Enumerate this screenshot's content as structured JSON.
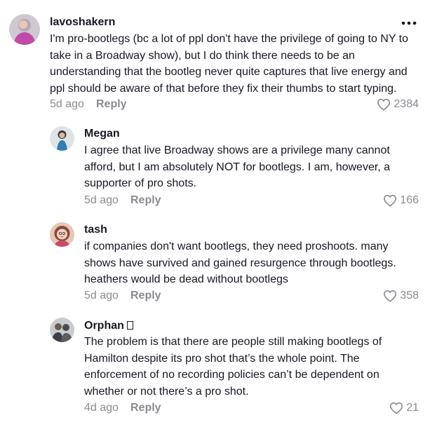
{
  "comments": [
    {
      "username": "lavoshakern",
      "text": "I'm pro-bootlegs (bc a lot of ppl don't have the privilege of going to NY to take in a Broadway show), but I do think there needs to be an understanding that the bootleg never quite captures that live energy and ppl should be aware of that before they fix their thumbs to start typing.",
      "time": "5d ago",
      "reply_label": "Reply",
      "likes": "2384"
    },
    {
      "username": "Megan",
      "text": "I agree that live Broadway shows are a privilege many cannot afford, but I am absolutely NOT for bootlegs. I am, however, a supporter of pro shots.",
      "time": "5d ago",
      "reply_label": "Reply",
      "likes": "166"
    },
    {
      "username": "tash",
      "text": "if companies don't want bootlegs, they need proshoots. many shows have survived and gained resurgence through bootlegs. heathers would be dead without bootlegs",
      "time": "5d ago",
      "reply_label": "Reply",
      "likes": "358"
    },
    {
      "username": "Orphan",
      "text": "The problem is that there are people still making bootlegs of Hamilton despite its pro shot that’s the whole point. The enforcement of no recording policies can’t be dependent on whether or not there’s a pro shot.",
      "time": "4d ago",
      "reply_label": "Reply",
      "likes": "21"
    }
  ],
  "icons": {
    "more": "more-options-icon",
    "like": "heart-outline-icon",
    "badge": "unknown-glyph-box"
  },
  "colors": {
    "text_primary": "#161823",
    "text_secondary": "#8a8b91",
    "background": "#ffffff"
  }
}
